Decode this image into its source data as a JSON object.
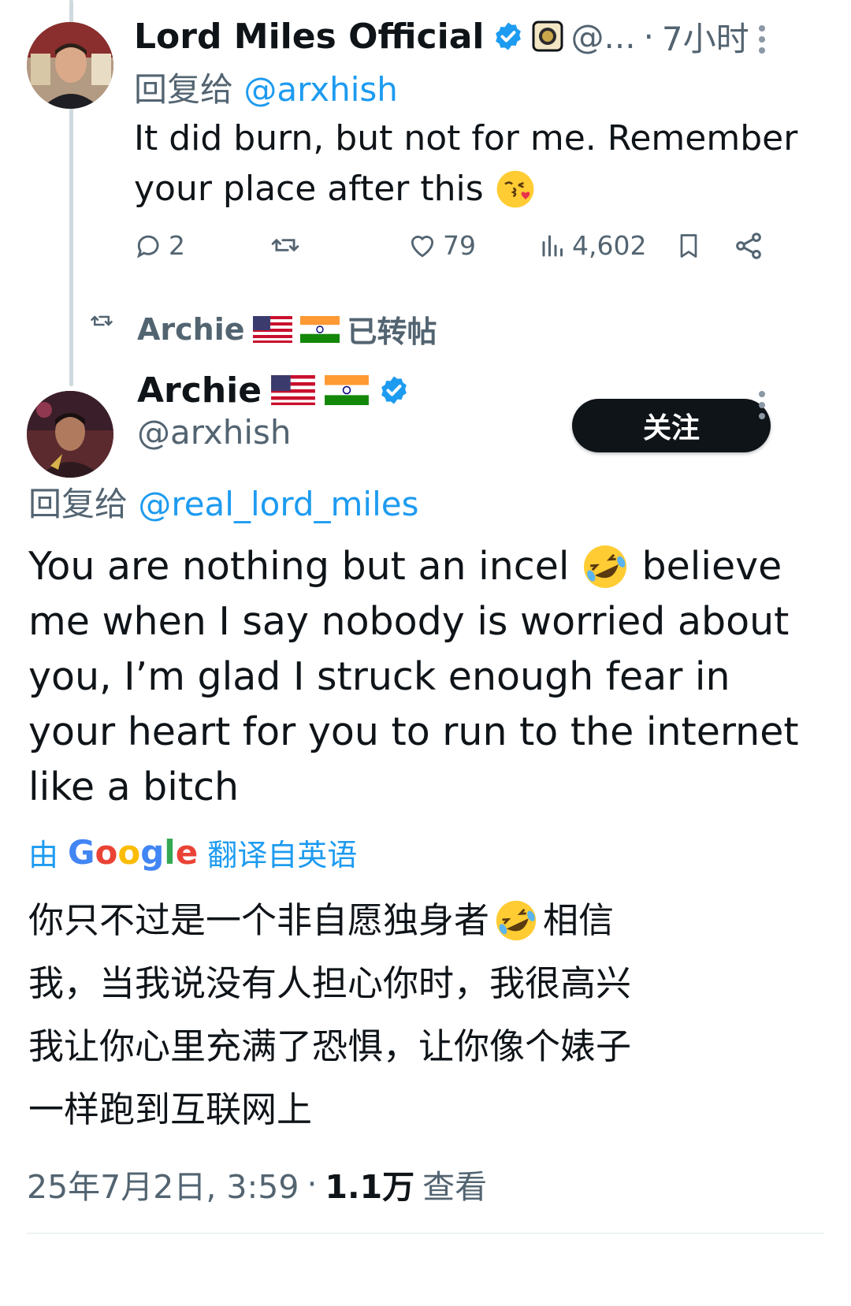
{
  "first_tweet": {
    "author_name": "Lord Miles Official",
    "handle_truncated": "@...",
    "separator": "·",
    "time": "7小时",
    "reply_prefix": "回复给",
    "reply_to": "@arxhish",
    "text_line1": "It did burn, but not for me. Remember",
    "text_line2": "your place after this",
    "emoji": "kissing-face-emoji",
    "replies": "2",
    "likes": "79",
    "views": "4,602"
  },
  "repost_banner": {
    "name": "Archie",
    "label": "已转帖"
  },
  "main_tweet": {
    "author_name": "Archie",
    "handle": "@arxhish",
    "follow_label": "关注",
    "reply_prefix": "回复给",
    "reply_to": "@real_lord_miles",
    "text_lines": [
      "You are nothing but an incel",
      "believe",
      "me when I say nobody is worried about",
      "you, I’m glad I struck enough fear in",
      "your heart for you to run to the internet",
      "like a bitch"
    ],
    "translate_prefix": "由",
    "translate_brand": "Google",
    "translate_suffix": "翻译自英语",
    "translated_lines": [
      "你只不过是一个非自愿独身者",
      "相信",
      "我，当我说没有人担心你时，我很高兴",
      "我让你心里充满了恐惧，让你像个婊子",
      "一样跑到互联网上"
    ],
    "date": "25年7月2日, 3:59",
    "dot": "·",
    "views_count": "1.1万",
    "views_label": "查看"
  },
  "colors": {
    "accent": "#1d9bf0",
    "text": "#0f1419",
    "muted": "#536471",
    "button_bg": "#0f1419"
  }
}
